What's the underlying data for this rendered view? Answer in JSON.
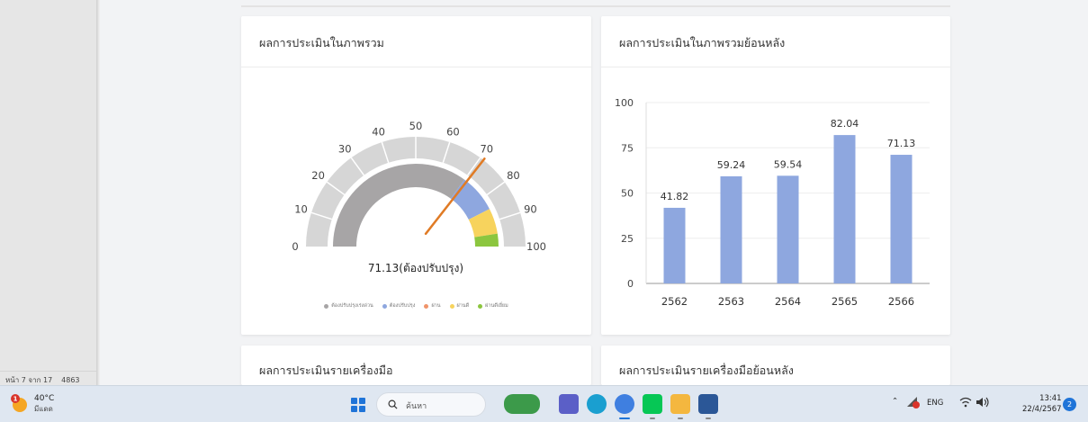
{
  "status_bar": {
    "page": "หน้า 7 จาก 17",
    "words": "4863"
  },
  "cards": {
    "overall": {
      "title": "ผลการประเมินในภาพรวม"
    },
    "overall_history": {
      "title": "ผลการประเมินในภาพรวมย้อนหลัง"
    },
    "by_tool": {
      "title": "ผลการประเมินรายเครื่องมือ"
    },
    "by_tool_history": {
      "title": "ผลการประเมินรายเครื่องมือย้อนหลัง"
    }
  },
  "gauge": {
    "value": 71.13,
    "value_label": "71.13(ต้องปรับปรุง)",
    "min": 0,
    "max": 100,
    "ticks": [
      "0",
      "10",
      "20",
      "30",
      "40",
      "50",
      "60",
      "70",
      "80",
      "90",
      "100"
    ],
    "bands": [
      {
        "from": 0,
        "to": 70,
        "color": "#a7a5a6"
      },
      {
        "from": 70,
        "to": 85,
        "color": "#8ea7df"
      },
      {
        "from": 85,
        "to": 95,
        "color": "#f7d35d"
      },
      {
        "from": 95,
        "to": 100,
        "color": "#8cc63f"
      }
    ],
    "needle_color": "#e07b25",
    "legend": [
      {
        "label": "ต้องปรับปรุงเร่งด่วน",
        "color": "#a7a5a6"
      },
      {
        "label": "ต้องปรับปรุง",
        "color": "#8ea7df"
      },
      {
        "label": "ผ่าน",
        "color": "#f0946a"
      },
      {
        "label": "ผ่านดี",
        "color": "#f7d35d"
      },
      {
        "label": "ผ่านดีเยี่ยม",
        "color": "#8cc63f"
      }
    ]
  },
  "chart_data": {
    "type": "bar",
    "categories": [
      "2562",
      "2563",
      "2564",
      "2565",
      "2566"
    ],
    "values": [
      41.82,
      59.24,
      59.54,
      82.04,
      71.13
    ],
    "data_labels": [
      "41.82",
      "59.24",
      "59.54",
      "82.04",
      "71.13"
    ],
    "y_ticks": [
      "0",
      "25",
      "50",
      "75",
      "100"
    ],
    "ylim": [
      0,
      100
    ],
    "title": "",
    "xlabel": "",
    "ylabel": "",
    "grid": true,
    "bar_color": "#8ea7df"
  },
  "taskbar": {
    "weather_temp": "40°C",
    "weather_desc": "มีแดด",
    "weather_badge": "1",
    "search_placeholder": "ค้นหา",
    "tray_lang": "ENG",
    "time": "13:41",
    "date": "22/4/2567",
    "notification_count": "2",
    "apps": [
      {
        "name": "turtle-app-icon",
        "color": "#3c9a4a"
      },
      {
        "name": "teams-chat-icon",
        "color": "#5b5fc7"
      },
      {
        "name": "edge-icon",
        "color": "#1a9fd0"
      },
      {
        "name": "chrome-icon",
        "color": "#3f7fe0"
      },
      {
        "name": "line-icon",
        "color": "#06c755"
      },
      {
        "name": "file-explorer-icon",
        "color": "#f4b73f"
      },
      {
        "name": "word-icon",
        "color": "#2b5797"
      }
    ]
  }
}
